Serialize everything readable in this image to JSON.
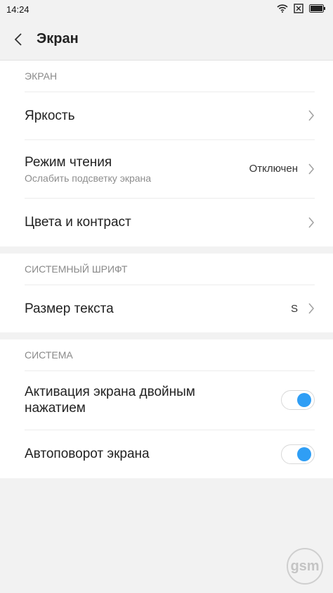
{
  "status_bar": {
    "time": "14:24"
  },
  "header": {
    "title": "Экран"
  },
  "sections": {
    "screen": {
      "title": "ЭКРАН",
      "brightness": "Яркость",
      "reading_mode": {
        "label": "Режим чтения",
        "sub": "Ослабить подсветку экрана",
        "value": "Отключен"
      },
      "colors": "Цвета и контраст"
    },
    "font": {
      "title": "СИСТЕМНЫЙ ШРИФТ",
      "text_size": {
        "label": "Размер текста",
        "value": "S"
      }
    },
    "system": {
      "title": "СИСТЕМА",
      "double_tap": {
        "label": "Активация экрана двойным нажатием",
        "state": "on"
      },
      "auto_rotate": {
        "label": "Автоповорот экрана",
        "state": "on"
      }
    }
  },
  "colors": {
    "accent": "#2f9ef5"
  },
  "watermark": {
    "text": "gsm"
  }
}
